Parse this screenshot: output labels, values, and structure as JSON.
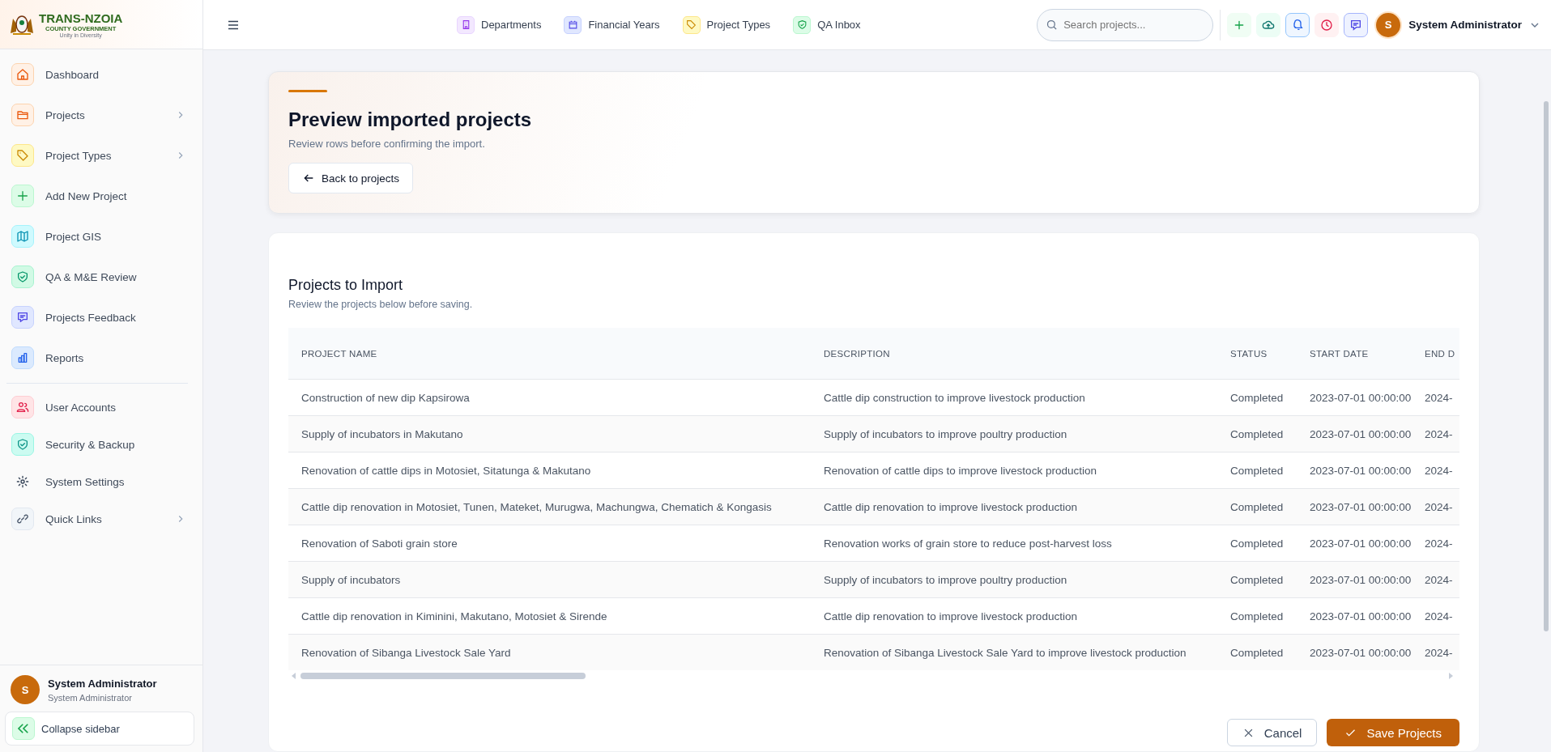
{
  "logo": {
    "title": "TRANS-NZOIA",
    "subtitle": "COUNTY GOVERNMENT",
    "motto": "Unity in Diversity"
  },
  "sidebar": {
    "items": [
      {
        "label": "Dashboard",
        "expandable": false
      },
      {
        "label": "Projects",
        "expandable": true
      },
      {
        "label": "Project Types",
        "expandable": true
      },
      {
        "label": "Add New Project",
        "expandable": false
      },
      {
        "label": "Project GIS",
        "expandable": false
      },
      {
        "label": "QA & M&E Review",
        "expandable": false
      },
      {
        "label": "Projects Feedback",
        "expandable": false
      },
      {
        "label": "Reports",
        "expandable": false
      }
    ],
    "admin_items": [
      {
        "label": "User Accounts",
        "expandable": false
      },
      {
        "label": "Security & Backup",
        "expandable": false
      },
      {
        "label": "System Settings",
        "expandable": false
      },
      {
        "label": "Quick Links",
        "expandable": true
      }
    ],
    "user": {
      "initial": "S",
      "name": "System Administrator",
      "role": "System Administrator"
    },
    "collapse": "Collapse sidebar"
  },
  "topbar": {
    "links": [
      "Departments",
      "Financial Years",
      "Project Types",
      "QA Inbox"
    ],
    "search": {
      "placeholder": "Search projects..."
    },
    "user": {
      "initial": "S",
      "name": "System Administrator"
    }
  },
  "header": {
    "title": "Preview imported projects",
    "subtitle": "Review rows before confirming the import.",
    "back": "Back to projects"
  },
  "table_card": {
    "title": "Projects to Import",
    "subtitle": "Review the projects below before saving.",
    "columns": [
      "PROJECT NAME",
      "DESCRIPTION",
      "STATUS",
      "START DATE",
      "END D"
    ],
    "rows": [
      [
        "Construction of new dip Kapsirowa",
        "Cattle dip construction to improve livestock production",
        "Completed",
        "2023-07-01 00:00:00",
        "2024-"
      ],
      [
        "Supply of incubators in Makutano",
        "Supply of incubators to improve poultry production",
        "Completed",
        "2023-07-01 00:00:00",
        "2024-"
      ],
      [
        "Renovation of cattle dips in Motosiet, Sitatunga & Makutano",
        "Renovation of cattle dips to improve livestock production",
        "Completed",
        "2023-07-01 00:00:00",
        "2024-"
      ],
      [
        "Cattle dip renovation in Motosiet, Tunen, Mateket, Murugwa, Machungwa, Chematich & Kongasis",
        "Cattle dip renovation to improve livestock production",
        "Completed",
        "2023-07-01 00:00:00",
        "2024-"
      ],
      [
        "Renovation of Saboti grain store",
        "Renovation works of grain store to reduce post-harvest loss",
        "Completed",
        "2023-07-01 00:00:00",
        "2024-"
      ],
      [
        "Supply of incubators",
        "Supply of incubators to improve poultry production",
        "Completed",
        "2023-07-01 00:00:00",
        "2024-"
      ],
      [
        "Cattle dip renovation in Kiminini, Makutano, Motosiet & Sirende",
        "Cattle dip renovation to improve livestock production",
        "Completed",
        "2023-07-01 00:00:00",
        "2024-"
      ],
      [
        "Renovation of Sibanga Livestock Sale Yard",
        "Renovation of Sibanga Livestock Sale Yard to improve livestock production",
        "Completed",
        "2023-07-01 00:00:00",
        "2024-"
      ]
    ],
    "buttons": {
      "cancel": "Cancel",
      "save": "Save Projects"
    }
  }
}
